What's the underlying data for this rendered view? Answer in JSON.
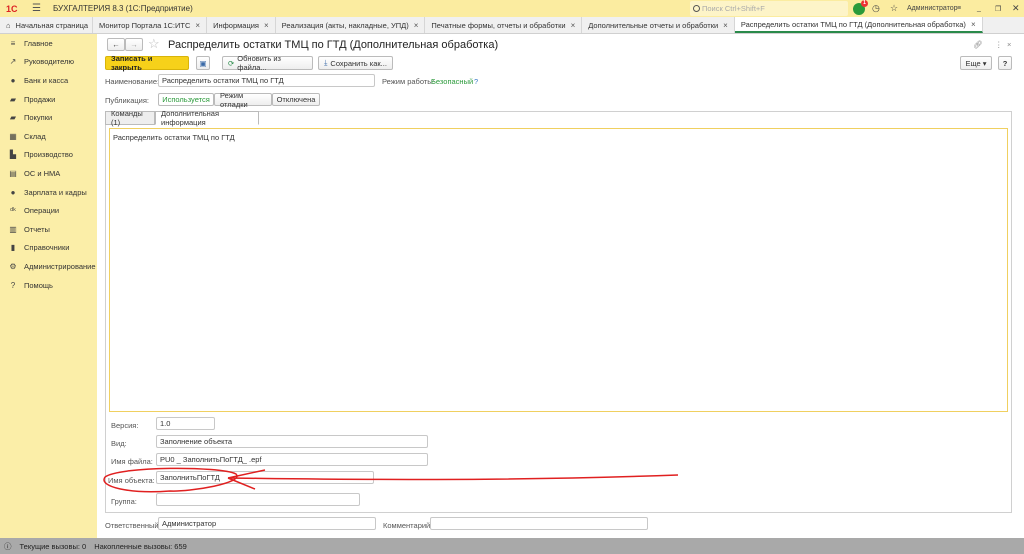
{
  "app": {
    "logo": "1С",
    "title": "БУХГАЛТЕРИЯ 8.3  (1С:Предприятие)",
    "search_placeholder": "Поиск Ctrl+Shift+F",
    "notifications": "1",
    "user": "Администратор"
  },
  "tabs": [
    {
      "label": "Начальная страница"
    },
    {
      "label": "Монитор Портала 1С:ИТС"
    },
    {
      "label": "Информация"
    },
    {
      "label": "Реализация (акты, накладные, УПД)"
    },
    {
      "label": "Печатные формы, отчеты и обработки"
    },
    {
      "label": "Дополнительные отчеты и обработки"
    },
    {
      "label": "Распределить остатки ТМЦ по ГТД (Дополнительная обработка)"
    }
  ],
  "sidebar": {
    "items": [
      {
        "label": "Главное",
        "icon": "≡"
      },
      {
        "label": "Руководителю",
        "icon": "↗"
      },
      {
        "label": "Банк и касса",
        "icon": "●"
      },
      {
        "label": "Продажи",
        "icon": "▰"
      },
      {
        "label": "Покупки",
        "icon": "▰"
      },
      {
        "label": "Склад",
        "icon": "▦"
      },
      {
        "label": "Производство",
        "icon": "▙"
      },
      {
        "label": "ОС и НМА",
        "icon": "▤"
      },
      {
        "label": "Зарплата и кадры",
        "icon": "●"
      },
      {
        "label": "Операции",
        "icon": "ᵈᵏ"
      },
      {
        "label": "Отчеты",
        "icon": "▥"
      },
      {
        "label": "Справочники",
        "icon": "▮"
      },
      {
        "label": "Администрирование",
        "icon": "⚙"
      },
      {
        "label": "Помощь",
        "icon": "?"
      }
    ]
  },
  "form": {
    "title": "Распределить остатки ТМЦ по ГТД (Дополнительная обработка)",
    "save_close": "Записать и закрыть",
    "update_from_file": "Обновить из файла...",
    "save_as": "Сохранить как...",
    "more": "Еще",
    "help": "?",
    "name_label": "Наименование:",
    "name_value": "Распределить остатки ТМЦ по ГТД",
    "mode_label": "Режим работы:",
    "mode_value": "Безопасный",
    "mode_help": "?",
    "publication_label": "Публикация:",
    "publication_options": [
      "Используется",
      "Режим отладки",
      "Отключена"
    ],
    "inner_tabs": [
      "Команды (1)",
      "Дополнительная информация"
    ],
    "info_text": "Распределить остатки ТМЦ по ГТД",
    "version_label": "Версия:",
    "version_value": "1.0",
    "kind_label": "Вид:",
    "kind_value": "Заполнение объекта",
    "file_label": "Имя файла:",
    "file_value": "PU0 _ ЗаполнитьПоГТД_ .epf",
    "object_label": "Имя объекта:",
    "object_value": "ЗаполнитьПоГТД",
    "group_label": "Группа:",
    "group_value": "",
    "responsible_label": "Ответственный:",
    "responsible_value": "Администратор",
    "comment_label": "Комментарий:",
    "comment_value": ""
  },
  "status": {
    "current": "Текущие вызовы: 0",
    "accumulated": "Накопленные вызовы: 659"
  },
  "colors": {
    "accent": "#f5d21e",
    "green": "#2a9a3a",
    "annotation": "#e02020"
  }
}
